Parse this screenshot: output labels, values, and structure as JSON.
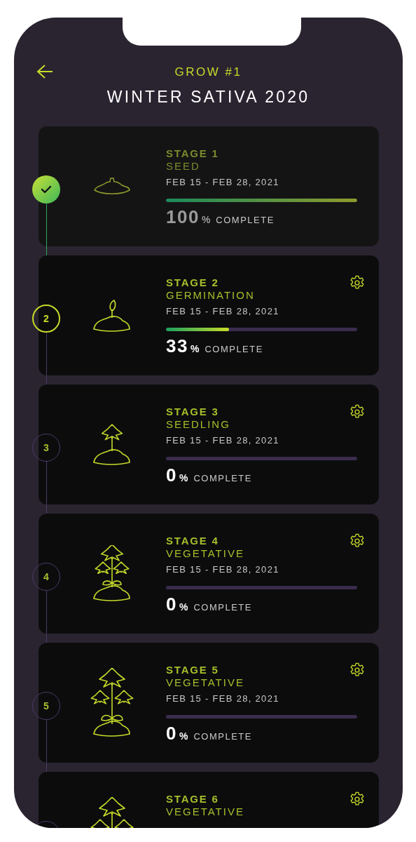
{
  "header": {
    "subtitle": "GROW #1",
    "title": "WINTER SATIVA 2020"
  },
  "stages": [
    {
      "done": true,
      "active": false,
      "label": "STAGE 1",
      "name": "SEED",
      "dates": "FEB 15 - FEB 28, 2021",
      "level": 1,
      "percent": "100",
      "percent_sign": "%",
      "complete_label": "COMPLETE",
      "settings": false,
      "kind": "seed"
    },
    {
      "step": "2",
      "done": false,
      "active": true,
      "label": "STAGE 2",
      "name": "GERMINATION",
      "dates": "FEB 15 - FEB 28, 2021",
      "level": 0.33,
      "percent": "33",
      "percent_sign": "%",
      "complete_label": "COMPLETE",
      "settings": true,
      "kind": "sprout"
    },
    {
      "step": "3",
      "done": false,
      "active": false,
      "label": "STAGE 3",
      "name": "SEEDLING",
      "dates": "FEB 15 - FEB 28, 2021",
      "level": 0,
      "percent": "0",
      "percent_sign": "%",
      "complete_label": "COMPLETE",
      "settings": true,
      "kind": "seedling"
    },
    {
      "step": "4",
      "done": false,
      "active": false,
      "label": "STAGE 4",
      "name": "VEGETATIVE",
      "dates": "FEB 15 - FEB 28, 2021",
      "level": 0,
      "percent": "0",
      "percent_sign": "%",
      "complete_label": "COMPLETE",
      "settings": true,
      "kind": "plant"
    },
    {
      "step": "5",
      "done": false,
      "active": false,
      "label": "STAGE 5",
      "name": "VEGETATIVE",
      "dates": "FEB 15 - FEB 28, 2021",
      "level": 0,
      "percent": "0",
      "percent_sign": "%",
      "complete_label": "COMPLETE",
      "settings": true,
      "kind": "bush"
    },
    {
      "done": false,
      "active": false,
      "label": "STAGE 6",
      "name": "VEGETATIVE",
      "settings": true,
      "kind": "bush"
    }
  ]
}
